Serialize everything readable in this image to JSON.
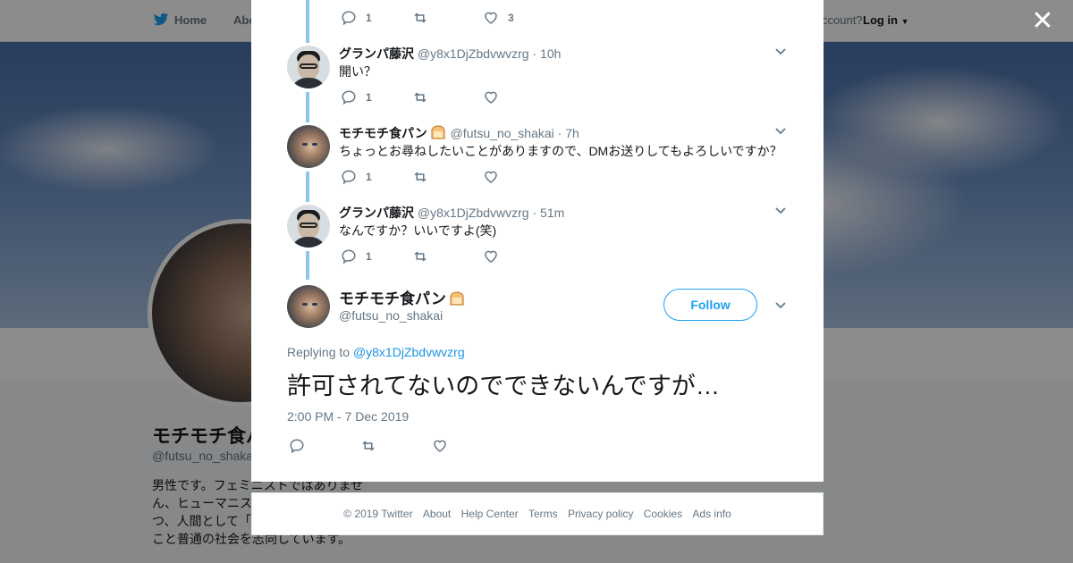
{
  "background": {
    "nav": {
      "home_label": "Home",
      "about_label": "Abo",
      "account_prompt": "ccount?",
      "login_label": "Log in"
    },
    "profile": {
      "name": "モチモチ食パ",
      "handle": "@futsu_no_shaka",
      "bio": "男性です。フェミニストではありません、ヒューマニストです。個を尊重しつつ、人間として「正しく生きる」ということ普通の社会を志向しています。"
    }
  },
  "modal": {
    "top_actions": {
      "reply_count": "1",
      "retweet_count": "",
      "like_count": "3"
    },
    "replies": [
      {
        "name": "グランパ藤沢",
        "handle": "@y8x1DjZbdvwvzrg",
        "time": "10h",
        "text": "開い？",
        "reply_count": "1",
        "avatar": "granpa"
      },
      {
        "name": "モチモチ食パン",
        "handle": "@futsu_no_shakai",
        "time": "7h",
        "text": "ちょっとお尋ねしたいことがありますので、DMお送りしてもよろしいですか？",
        "reply_count": "1",
        "avatar": "mochi"
      },
      {
        "name": "グランパ藤沢",
        "handle": "@y8x1DjZbdvwvzrg",
        "time": "51m",
        "text": "なんですか？いいですよ(笑)",
        "reply_count": "1",
        "avatar": "granpa"
      }
    ],
    "main_tweet": {
      "name": "モチモチ食パン",
      "handle": "@futsu_no_shakai",
      "follow_label": "Follow",
      "replying_to_label": "Replying to",
      "replying_to_handle": "@y8x1DjZbdvwvzrg",
      "text": "許可されてないのでできないんですが…",
      "timestamp": "2:00 PM - 7 Dec 2019"
    }
  },
  "footer": {
    "links": [
      "© 2019 Twitter",
      "About",
      "Help Center",
      "Terms",
      "Privacy policy",
      "Cookies",
      "Ads info"
    ]
  },
  "colors": {
    "accent": "#1da1f2",
    "thread_line": "#8ec5ef",
    "overlay": "rgba(0,0,0,0.45)"
  }
}
